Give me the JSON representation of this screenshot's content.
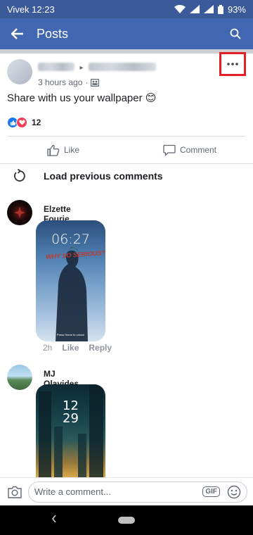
{
  "status_bar": {
    "carrier_time": "Vivek 12:23",
    "battery": "93%"
  },
  "header": {
    "title": "Posts",
    "back_icon": "arrow-left-icon",
    "search_icon": "search-icon"
  },
  "post": {
    "time": "3 hours ago",
    "text": "Share with us your wallpaper 😊",
    "reaction_count": "12",
    "actions": {
      "like": "Like",
      "comment": "Comment"
    }
  },
  "load_previous": "Load previous comments",
  "comments": [
    {
      "name": "Elzette Fourie",
      "time": "2h",
      "like": "Like",
      "reply": "Reply",
      "image": {
        "clock": "06:27",
        "overlay": "WHY SO SERIOUS?",
        "footer": "Press Home to unlock"
      }
    },
    {
      "name": "MJ Olavides",
      "image": {
        "clock": "12\n29"
      }
    }
  ],
  "composer": {
    "placeholder": "Write a comment...",
    "gif_label": "GIF"
  },
  "colors": {
    "brand": "#4267b2",
    "status": "#3b5a99",
    "highlight": "#e21f26"
  }
}
